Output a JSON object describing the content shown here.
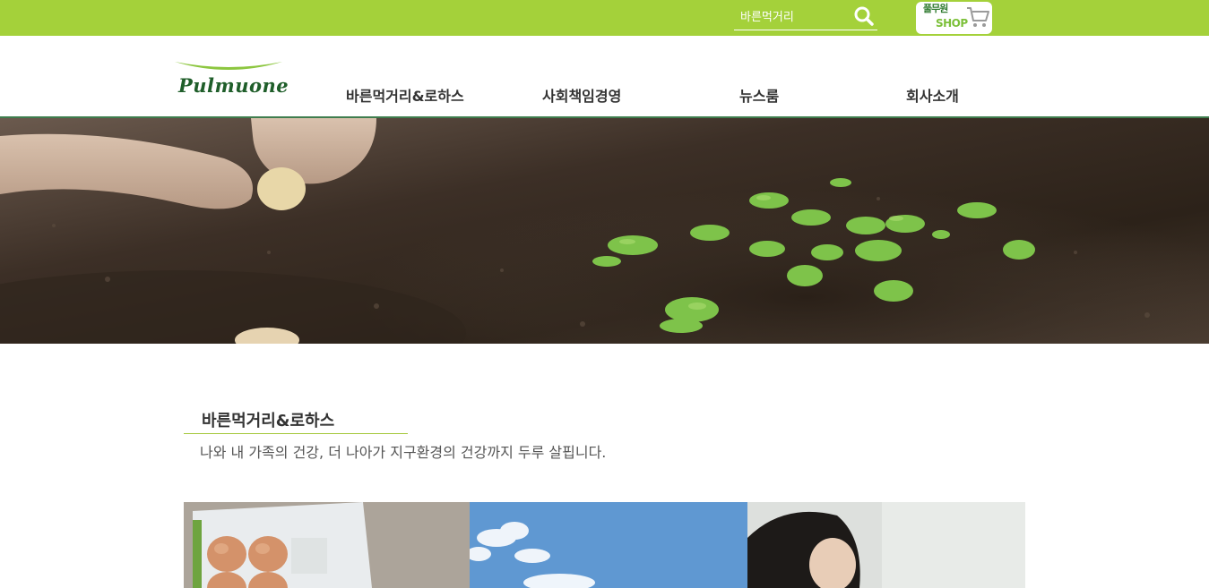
{
  "topbar": {
    "search_placeholder": "바른먹거리",
    "search_icon": "search-icon",
    "shop": {
      "brand": "풀무원",
      "label": "SHOP",
      "icon": "cart-icon"
    },
    "color": "#a4d13a"
  },
  "header": {
    "logo_text": "Pulmuone",
    "nav": [
      "바른먹거리&로하스",
      "사회책임경영",
      "뉴스룸",
      "회사소개"
    ],
    "border_color": "#3f7d4e"
  },
  "section": {
    "title": "바른먹거리&로하스",
    "description": "나와 내 가족의 건강, 더 나아가 지구환경의 건강까지 두루 살핍니다."
  },
  "cards": [
    {
      "name": "eggs-card",
      "icon": "egg-carton-image"
    },
    {
      "name": "sky-card",
      "icon": "sky-image"
    },
    {
      "name": "person-card",
      "icon": "person-image"
    }
  ]
}
